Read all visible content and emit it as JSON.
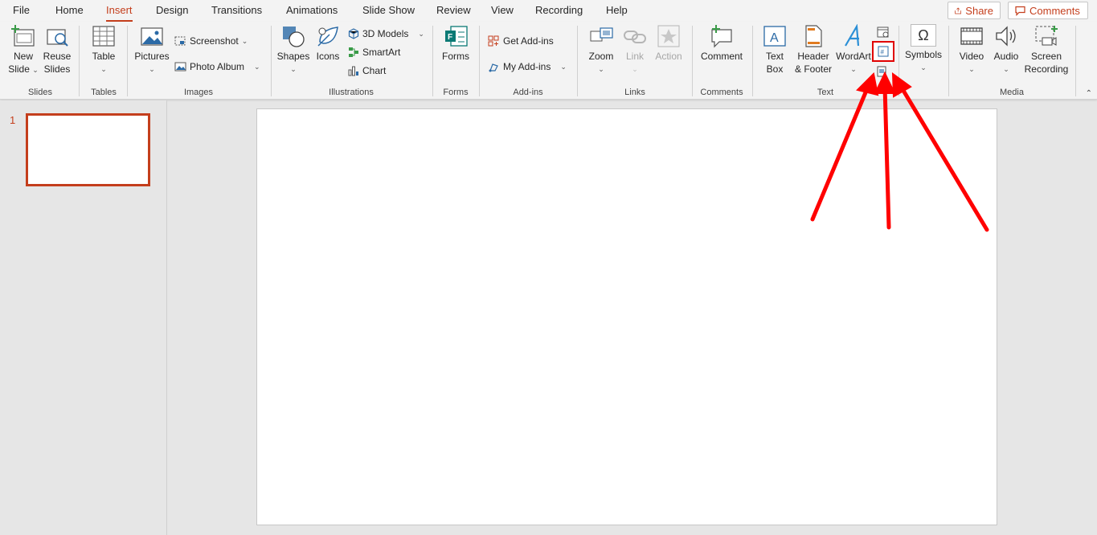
{
  "menu": {
    "tabs": [
      "File",
      "Home",
      "Insert",
      "Design",
      "Transitions",
      "Animations",
      "Slide Show",
      "Review",
      "View",
      "Recording",
      "Help"
    ],
    "active_tab": "Insert",
    "share_label": "Share",
    "comments_label": "Comments"
  },
  "ribbon": {
    "slides": {
      "group": "Slides",
      "new_slide": [
        "New",
        "Slide"
      ],
      "reuse_slides": [
        "Reuse",
        "Slides"
      ]
    },
    "tables": {
      "group": "Tables",
      "table": "Table"
    },
    "images": {
      "group": "Images",
      "pictures": "Pictures",
      "screenshot": "Screenshot",
      "photo_album": "Photo Album"
    },
    "illustrations": {
      "group": "Illustrations",
      "shapes": "Shapes",
      "icons": "Icons",
      "models_3d": "3D Models",
      "smartart": "SmartArt",
      "chart": "Chart"
    },
    "forms": {
      "group": "Forms",
      "forms": "Forms"
    },
    "addins": {
      "group": "Add-ins",
      "get_addins": "Get Add-ins",
      "my_addins": "My Add-ins"
    },
    "links": {
      "group": "Links",
      "zoom": "Zoom",
      "link": "Link",
      "action": "Action"
    },
    "comments": {
      "group": "Comments",
      "comment": "Comment"
    },
    "text": {
      "group": "Text",
      "text_box": [
        "Text",
        "Box"
      ],
      "header_footer": [
        "Header",
        "& Footer"
      ],
      "wordart": "WordArt"
    },
    "symbols": {
      "symbols": "Symbols"
    },
    "media": {
      "group": "Media",
      "video": "Video",
      "audio": "Audio",
      "screen_recording": [
        "Screen",
        "Recording"
      ]
    }
  },
  "slides_pane": {
    "slide_number": "1"
  },
  "colors": {
    "accent": "#c43e1c",
    "annotation": "#ff0000"
  }
}
